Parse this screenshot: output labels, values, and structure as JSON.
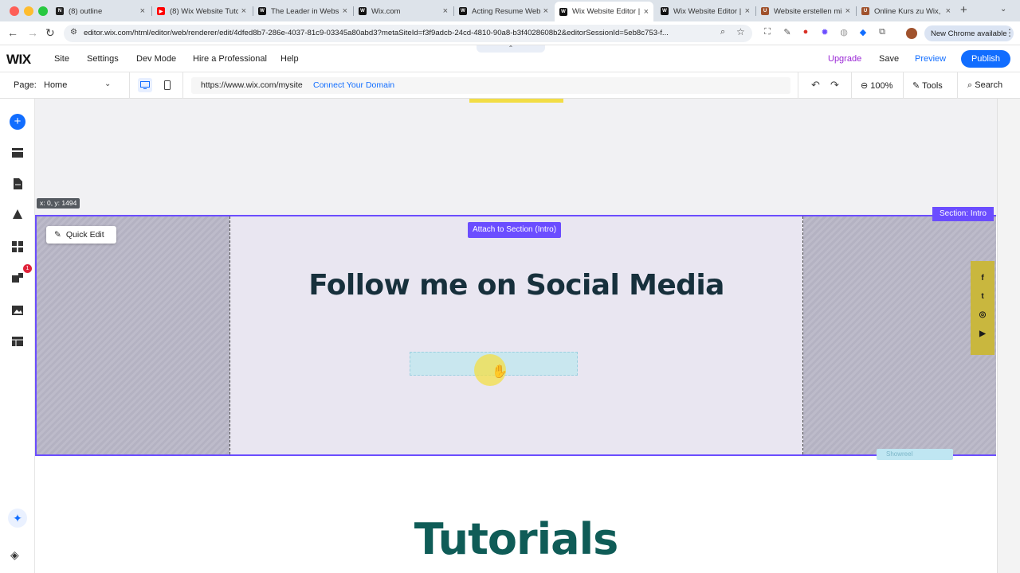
{
  "browser": {
    "tabs": [
      {
        "title": "(8) outline",
        "favicon": "N",
        "favicon_color": "#222222"
      },
      {
        "title": "(8) Wix Website Tuto",
        "favicon": "▶",
        "favicon_color": "#ff0000"
      },
      {
        "title": "The Leader in Websit",
        "favicon": "W",
        "favicon_color": "#111111"
      },
      {
        "title": "Wix.com",
        "favicon": "W",
        "favicon_color": "#111111"
      },
      {
        "title": "Acting Resume Webs",
        "favicon": "W",
        "favicon_color": "#111111"
      },
      {
        "title": "Wix Website Editor |",
        "favicon": "W",
        "favicon_color": "#111111"
      },
      {
        "title": "Wix Website Editor |",
        "favicon": "W",
        "favicon_color": "#111111"
      },
      {
        "title": "Website erstellen mi",
        "favicon": "U",
        "favicon_color": "#a0522d"
      },
      {
        "title": "Online Kurs zu Wix, I",
        "favicon": "U",
        "favicon_color": "#a0522d"
      }
    ],
    "address_url": "editor.wix.com/html/editor/web/renderer/edit/4dfed8b7-286e-4037-81c9-03345a80abd3?metaSiteId=f3f9adcb-24cd-4810-90a8-b3f4028608b2&editorSessionId=5eb8c753-f...",
    "chrome_badge": "New Chrome available"
  },
  "wix_top": {
    "logo": "WIX",
    "menu": [
      "Site",
      "Settings",
      "Dev Mode",
      "Hire a Professional",
      "Help"
    ],
    "upgrade": "Upgrade",
    "save": "Save",
    "preview": "Preview",
    "publish": "Publish"
  },
  "wix_second": {
    "page_label": "Page:",
    "page_value": "Home",
    "site_url": "https://www.wix.com/mysite",
    "connect_domain": "Connect Your Domain",
    "zoom": "100%",
    "tools": "Tools",
    "search": "Search"
  },
  "left_rail": {
    "notification_count": "1"
  },
  "canvas": {
    "coord_readout": "x: 0, y: 1494",
    "quick_edit": "Quick Edit",
    "attach_label": "Attach to Section (Intro)",
    "section_tag": "Section: Intro",
    "heading": "Follow me on Social Media",
    "social_icons": [
      "f",
      "t",
      "◎",
      "▶"
    ],
    "showreel_label": "Showreel",
    "tutorials_heading": "Tutorials"
  },
  "colors": {
    "wix_blue": "#116dff",
    "section_purple": "#6b4dff",
    "upgrade_purple": "#9a27d5",
    "heading_dark": "#17303c",
    "tutorials_teal": "#0f5c57",
    "social_bar_gold": "#c9b73e"
  }
}
